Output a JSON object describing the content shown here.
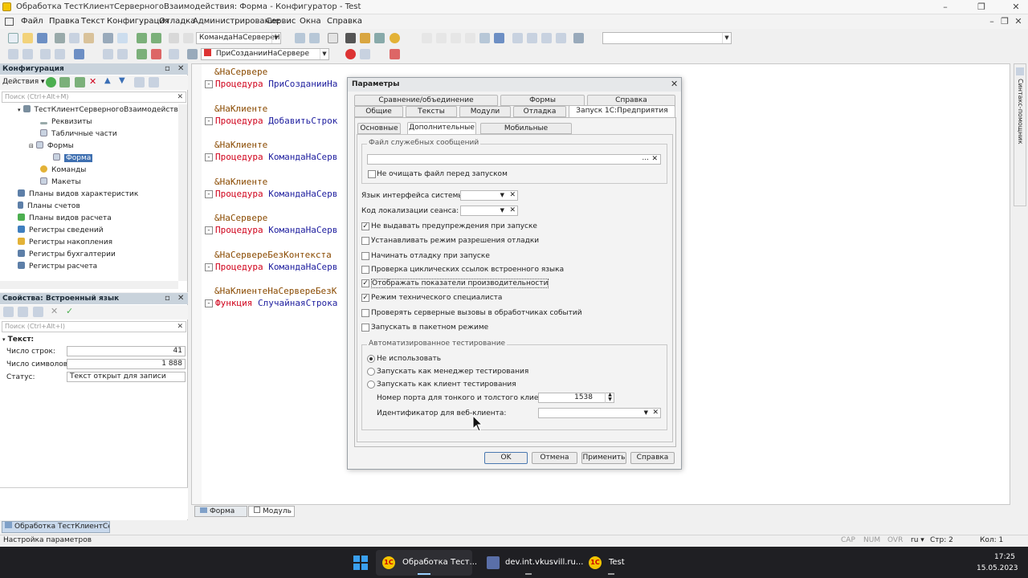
{
  "window": {
    "title": "Обработка ТестКлиентСерверногоВзаимодействия: Форма - Конфигуратор - Test"
  },
  "menu": [
    "Файл",
    "Правка",
    "Текст",
    "Конфигурация",
    "Отладка",
    "Администрирование",
    "Сервис",
    "Окна",
    "Справка"
  ],
  "toolbar": {
    "method_combo": "КомандаНаСервереНа",
    "proc_combo": "ПриСозданииНаСервере"
  },
  "config_panel": {
    "title": "Конфигурация",
    "actions_label": "Действия",
    "search_placeholder": "Поиск (Ctrl+Alt+M)",
    "tree": [
      "ТестКлиентСерверногоВзаимодействия",
      "Реквизиты",
      "Табличные части",
      "Формы",
      "Форма",
      "Команды",
      "Макеты",
      "Планы видов характеристик",
      "Планы счетов",
      "Планы видов расчета",
      "Регистры сведений",
      "Регистры накопления",
      "Регистры бухгалтерии",
      "Регистры расчета"
    ]
  },
  "props_panel": {
    "title": "Свойства: Встроенный язык",
    "search_placeholder": "Поиск (Ctrl+Alt+I)",
    "section": "Текст:",
    "rows": [
      {
        "label": "Число строк:",
        "value": "41"
      },
      {
        "label": "Число символов:",
        "value": "1 888"
      },
      {
        "label": "Статус:",
        "value": "Текст открыт для записи"
      }
    ]
  },
  "code": [
    {
      "directive": "&НаСервере",
      "keyword": "Процедура",
      "name": "ПриСозданииНа"
    },
    {
      "directive": "&НаКлиенте",
      "keyword": "Процедура",
      "name": "ДобавитьСтрок"
    },
    {
      "directive": "&НаКлиенте",
      "keyword": "Процедура",
      "name": "КомандаНаСерв"
    },
    {
      "directive": "&НаКлиенте",
      "keyword": "Процедура",
      "name": "КомандаНаСерв"
    },
    {
      "directive": "&НаСервере",
      "keyword": "Процедура",
      "name": "КомандаНаСерв"
    },
    {
      "directive": "&НаСервереБезКонтекста",
      "keyword": "Процедура",
      "name": "КомандаНаСерв"
    },
    {
      "directive": "&НаКлиентеНаСервереБезК",
      "keyword": "Функция",
      "name": "СлучайнаяСтрока"
    }
  ],
  "editor_tabs": [
    "Форма",
    "Модуль"
  ],
  "side_helper": "Синтакс-помощник",
  "window_tab": "Обработка ТестКлиентСерв...",
  "dialog": {
    "title": "Параметры",
    "tabs_row1": [
      "Сравнение/объединение",
      "Формы",
      "Справка"
    ],
    "tabs_row2": [
      "Общие",
      "Тексты",
      "Модули",
      "Отладка",
      "Запуск 1С:Предприятия"
    ],
    "subtabs": [
      "Основные",
      "Дополнительные",
      "Мобильные приложения"
    ],
    "file_group": "Файл служебных сообщений",
    "no_clear_label": "Не очищать файл перед запуском",
    "lang_label": "Язык интерфейса системы:",
    "locale_label": "Код локализации сеанса:",
    "checks": [
      {
        "label": "Не выдавать предупреждения при запуске",
        "checked": true
      },
      {
        "label": "Устанавливать режим разрешения отладки",
        "checked": false
      },
      {
        "label": "Начинать отладку при запуске",
        "checked": false
      },
      {
        "label": "Проверка циклических ссылок встроенного языка",
        "checked": false
      },
      {
        "label": "Отображать показатели производительности",
        "checked": true
      },
      {
        "label": "Режим технического специалиста",
        "checked": true
      },
      {
        "label": "Проверять серверные вызовы в обработчиках событий",
        "checked": false
      },
      {
        "label": "Запускать в пакетном режиме",
        "checked": false
      }
    ],
    "auto_group": "Автоматизированное тестирование",
    "radios": [
      {
        "label": "Не использовать",
        "selected": true
      },
      {
        "label": "Запускать как менеджер тестирования",
        "selected": false
      },
      {
        "label": "Запускать как клиент тестирования",
        "selected": false
      }
    ],
    "port_label": "Номер порта для тонкого и толстого клиентов:",
    "port_value": "1538",
    "webid_label": "Идентификатор для веб-клиента:",
    "buttons": [
      "OK",
      "Отмена",
      "Применить",
      "Справка"
    ]
  },
  "status": {
    "text": "Настройка параметров",
    "cap": "CAP",
    "num": "NUM",
    "ovr": "OVR",
    "lang": "ru",
    "line": "Стр: 2",
    "col": "Кол: 1"
  },
  "taskbar": {
    "items": [
      "Обработка Тест...",
      "dev.int.vkusvill.ru...",
      "Test"
    ],
    "time": "17:25",
    "date": "15.05.2023"
  }
}
